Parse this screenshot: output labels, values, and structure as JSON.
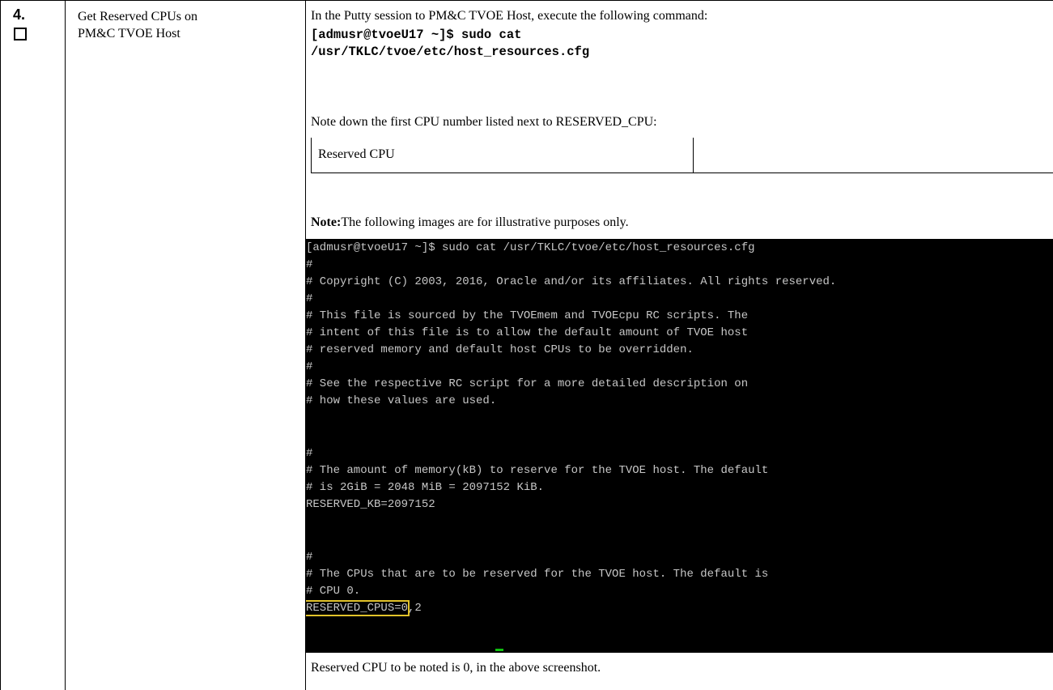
{
  "step": {
    "number": "4.",
    "title": "Get Reserved CPUs on PM&C TVOE Host"
  },
  "procedure": {
    "instruction": "In the Putty session to PM&C TVOE Host, execute the following command:",
    "command_line1": "[admusr@tvoeU17 ~]$ sudo cat",
    "command_line2": "/usr/TKLC/tvoe/etc/host_resources.cfg",
    "note_down": "Note down the first CPU number listed next to RESERVED_CPU:",
    "reserved_cpu_label": "Reserved CPU",
    "reserved_cpu_value": "",
    "note_bold": "Note:",
    "note_text": "The following images are for illustrative purposes only.",
    "conclusion": "Reserved CPU to be noted is 0, in the above screenshot."
  },
  "terminal": {
    "line01": "[admusr@tvoeU17 ~]$ sudo cat /usr/TKLC/tvoe/etc/host_resources.cfg",
    "line02": "#",
    "line03": "# Copyright (C) 2003, 2016, Oracle and/or its affiliates. All rights reserved.",
    "line04": "#",
    "line05": "# This file is sourced by the TVOEmem and TVOEcpu RC scripts. The",
    "line06": "# intent of this file is to allow the default amount of TVOE host",
    "line07": "# reserved memory and default host CPUs to be overridden.",
    "line08": "#",
    "line09": "# See the respective RC script for a more detailed description on",
    "line10": "# how these values are used.",
    "line11": "#",
    "line12": "# The amount of memory(kB) to reserve for the TVOE host. The default",
    "line13": "# is 2GiB = 2048 MiB = 2097152 KiB.",
    "line14": "RESERVED_KB=2097152",
    "line15": "#",
    "line16": "# The CPUs that are to be reserved for the TVOE host. The default is",
    "line17": "# CPU 0.",
    "line18_highlight": "RESERVED_CPUS=0",
    "line18_rest": ",2",
    "highlight_color": "#e1c22a",
    "text_color": "#c6c6c6",
    "background": "#000000"
  }
}
